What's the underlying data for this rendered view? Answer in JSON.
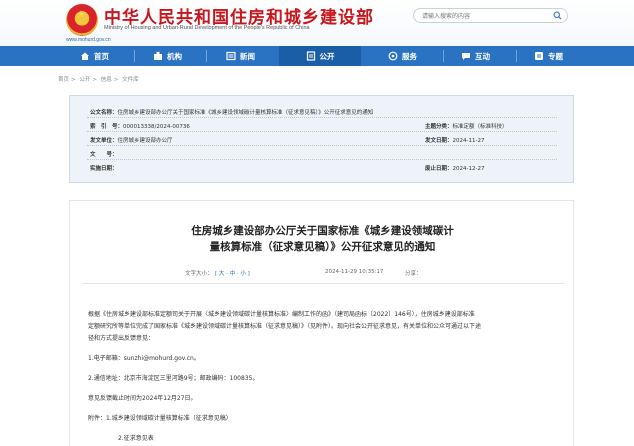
{
  "header": {
    "site_title": "中华人民共和国住房和城乡建设部",
    "site_subtitle": "Ministry of Housing and Urban-Rural Development of the People's Republic of China",
    "site_url": "www.mohurd.gov.cn",
    "search_placeholder": "请输入搜索的内容"
  },
  "nav": {
    "items": [
      {
        "label": "首页",
        "icon": "home-icon"
      },
      {
        "label": "机构",
        "icon": "org-icon"
      },
      {
        "label": "新闻",
        "icon": "news-icon"
      },
      {
        "label": "公开",
        "icon": "open-icon"
      },
      {
        "label": "服务",
        "icon": "service-icon"
      },
      {
        "label": "互动",
        "icon": "chat-icon"
      },
      {
        "label": "专题",
        "icon": "topic-icon"
      }
    ],
    "active": "公开"
  },
  "breadcrumb": [
    "首页",
    "公开",
    "信息",
    "文件库"
  ],
  "info": {
    "title_label": "公文名称：",
    "title_value": "住房城乡建设部办公厅关于国家标准《城乡建设领域碳计量核算标准（征求意见稿）》公开征求意见的通知",
    "index_label": "索　引　号：",
    "index_value": "000013338/2024-00736",
    "category_label": "主题分类：",
    "category_value": "标准定额（标准科技）",
    "org_label": "发文单位：",
    "org_value": "住房城乡建设部办公厅",
    "date_label": "发文日期：",
    "date_value": "2024-11-27",
    "doc_no_label": "文　　号：",
    "doc_no_value": "",
    "effective_label": "实施日期：",
    "effective_value": "",
    "abolish_label": "废止日期：",
    "abolish_value": "2024-12-27"
  },
  "article": {
    "title_line1": "住房城乡建设部办公厅关于国家标准《城乡建设领域碳计",
    "title_line2": "量核算标准（征求意见稿）》公开征求意见的通知",
    "font_label": "文字大小：",
    "font_sizes": "[ 大 · 中 · 小 ]",
    "date_text": "2024-11-29 10:35:17",
    "share_label": "分享：",
    "paragraphs": [
      "根据《住房城乡建设部标准定额司关于开展〈城乡建设领域碳计量核算标准〉编制工作的函》（建司局函标〔2022〕146号），住房城乡建设部标准",
      "定额研究所等单位完成了国家标准《城乡建设领域碳计量核算标准（征求意见稿）》（见附件）。现向社会公开征求意见，有关单位和公众可通过以下途",
      "径和方式提出反馈意见：",
      "1.电子邮箱：sunzhi@mohurd.gov.cn。",
      "2.通信地址：北京市海淀区三里河路9号；邮政编码：100835。",
      "意见反馈截止时间为2024年12月27日。",
      "附件：1.城乡建设领域碳计量核算标准（征求意见稿）",
      "2.征求意见表"
    ]
  },
  "colors": {
    "title_red": "#c8161d",
    "nav_blue": "#2a72c2",
    "nav_active": "#1b5ea8",
    "info_bg": "#eef3fa"
  }
}
